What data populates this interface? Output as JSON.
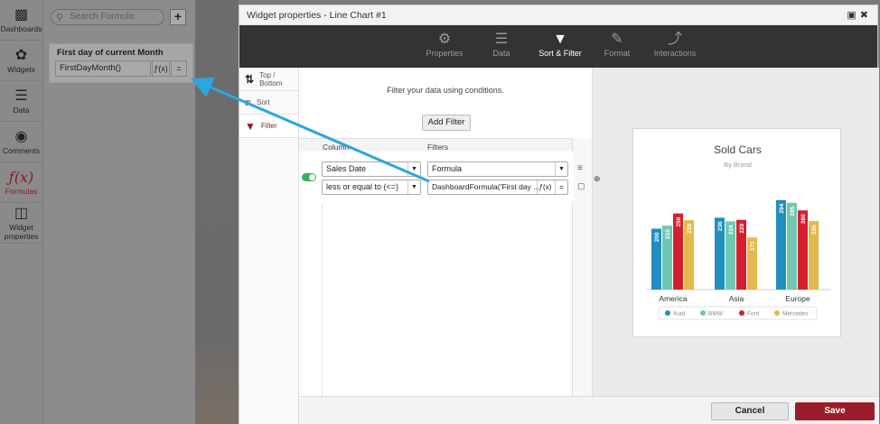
{
  "nav": {
    "items": [
      {
        "label": "Dashboards",
        "icon": "bar-chart-icon"
      },
      {
        "label": "Widgets",
        "icon": "palette-icon"
      },
      {
        "label": "Data",
        "icon": "database-icon"
      },
      {
        "label": "Comments",
        "icon": "comments-icon"
      },
      {
        "label": "Formulas",
        "icon": "formula-icon"
      },
      {
        "label": "Widget properties",
        "icon": "window-icon"
      }
    ]
  },
  "formulas_panel": {
    "search_placeholder": "Search Formula",
    "add_label": "+",
    "card": {
      "title": "First day of current Month",
      "value": "FirstDayMonth()",
      "fx_label": "ƒ(x)",
      "eq_label": "="
    }
  },
  "modal": {
    "title": "Widget properties - Line Chart #1",
    "tabs": [
      {
        "label": "Properties",
        "icon": "gear-icon"
      },
      {
        "label": "Data",
        "icon": "database-icon"
      },
      {
        "label": "Sort & Filter",
        "icon": "filter-icon"
      },
      {
        "label": "Format",
        "icon": "pencil-icon"
      },
      {
        "label": "Interactions",
        "icon": "bolt-icon"
      }
    ],
    "subtabs": [
      {
        "label": "Top / Bottom",
        "icon": "updown-icon"
      },
      {
        "label": "Sort",
        "icon": "sort-icon"
      },
      {
        "label": "Filter",
        "icon": "filter-icon"
      }
    ],
    "filter": {
      "hint": "Filter your data using conditions.",
      "add_label": "Add Filter",
      "col_header": "Column",
      "filters_header": "Filters",
      "row": {
        "column": "Sales Date",
        "operator": "less or equal to (<=)",
        "filter_type": "Formula",
        "formula_value": "DashboardFormula('First day ...",
        "fx_label": "ƒ(x)",
        "eq_label": "="
      }
    },
    "cancel_label": "Cancel",
    "save_label": "Save"
  },
  "chart_data": {
    "type": "bar",
    "title": "Sold Cars",
    "subtitle": "By Brand",
    "categories": [
      "America",
      "Asia",
      "Europe"
    ],
    "series": [
      {
        "name": "Audi",
        "color": "#1f8fbf",
        "values": [
          200,
          236,
          294
        ]
      },
      {
        "name": "BMW",
        "color": "#6fc7b1",
        "values": [
          210,
          224,
          285
        ]
      },
      {
        "name": "Ford",
        "color": "#d2202e",
        "values": [
          250,
          229,
          260
        ]
      },
      {
        "name": "Mercedes",
        "color": "#e3b94b",
        "values": [
          228,
          171,
          225
        ]
      }
    ],
    "ylim": [
      0,
      320
    ],
    "legend": "bottom"
  }
}
